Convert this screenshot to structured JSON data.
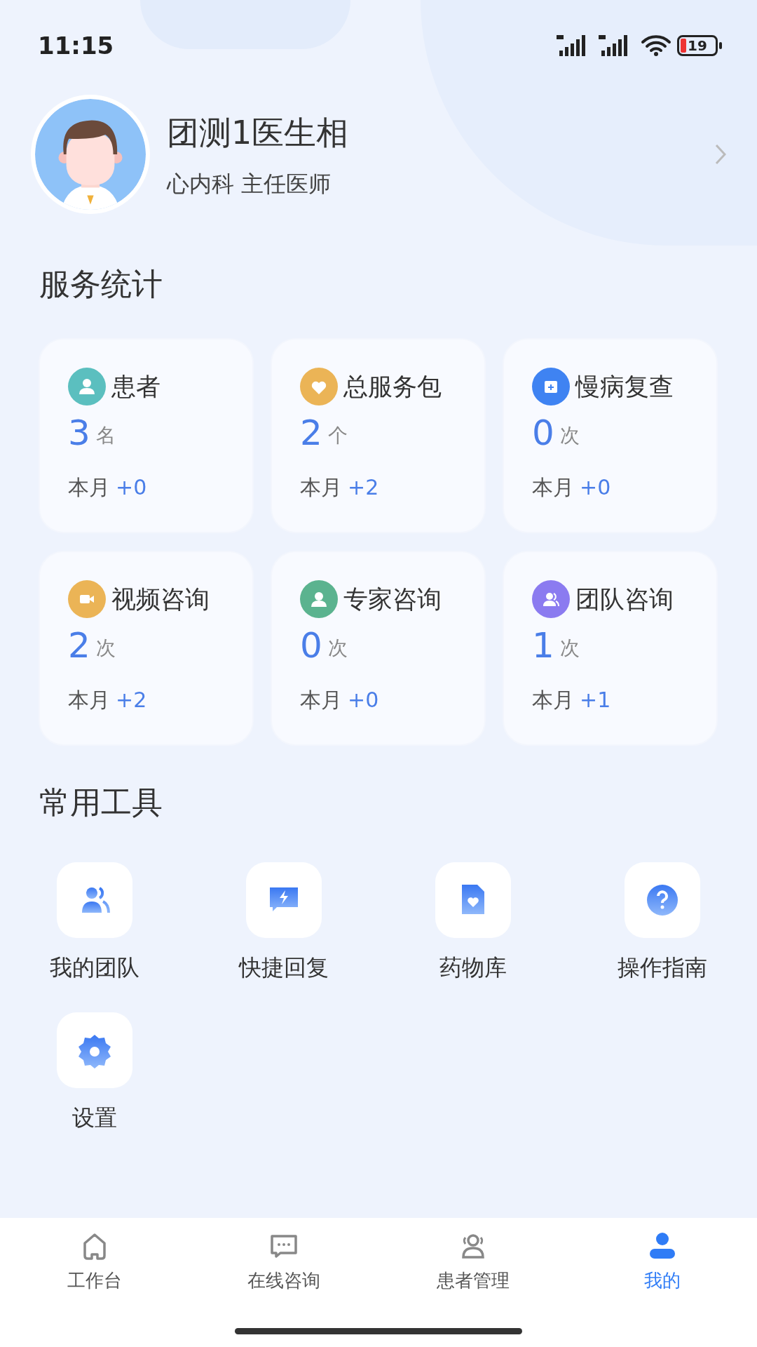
{
  "status_bar": {
    "time": "11:15",
    "battery": "19"
  },
  "profile": {
    "name": "团测1医生相",
    "subtitle": "心内科 主任医师"
  },
  "service_stats": {
    "title": "服务统计",
    "cards": [
      {
        "title": "患者",
        "value": "3",
        "unit": "名",
        "period": "本月",
        "delta": "+0",
        "color": "#5bbfbf"
      },
      {
        "title": "总服务包",
        "value": "2",
        "unit": "个",
        "period": "本月",
        "delta": "+2",
        "color": "#ebb456"
      },
      {
        "title": "慢病复查",
        "value": "0",
        "unit": "次",
        "period": "本月",
        "delta": "+0",
        "color": "#3f83f2"
      },
      {
        "title": "视频咨询",
        "value": "2",
        "unit": "次",
        "period": "本月",
        "delta": "+2",
        "color": "#ebb456"
      },
      {
        "title": "专家咨询",
        "value": "0",
        "unit": "次",
        "period": "本月",
        "delta": "+0",
        "color": "#5bb38f"
      },
      {
        "title": "团队咨询",
        "value": "1",
        "unit": "次",
        "period": "本月",
        "delta": "+1",
        "color": "#8b7bf0"
      }
    ]
  },
  "tools": {
    "title": "常用工具",
    "items": [
      {
        "label": "我的团队"
      },
      {
        "label": "快捷回复"
      },
      {
        "label": "药物库"
      },
      {
        "label": "操作指南"
      },
      {
        "label": "设置"
      }
    ]
  },
  "tab_bar": [
    {
      "label": "工作台",
      "selected": false
    },
    {
      "label": "在线咨询",
      "selected": false
    },
    {
      "label": "患者管理",
      "selected": false
    },
    {
      "label": "我的",
      "selected": true
    }
  ]
}
